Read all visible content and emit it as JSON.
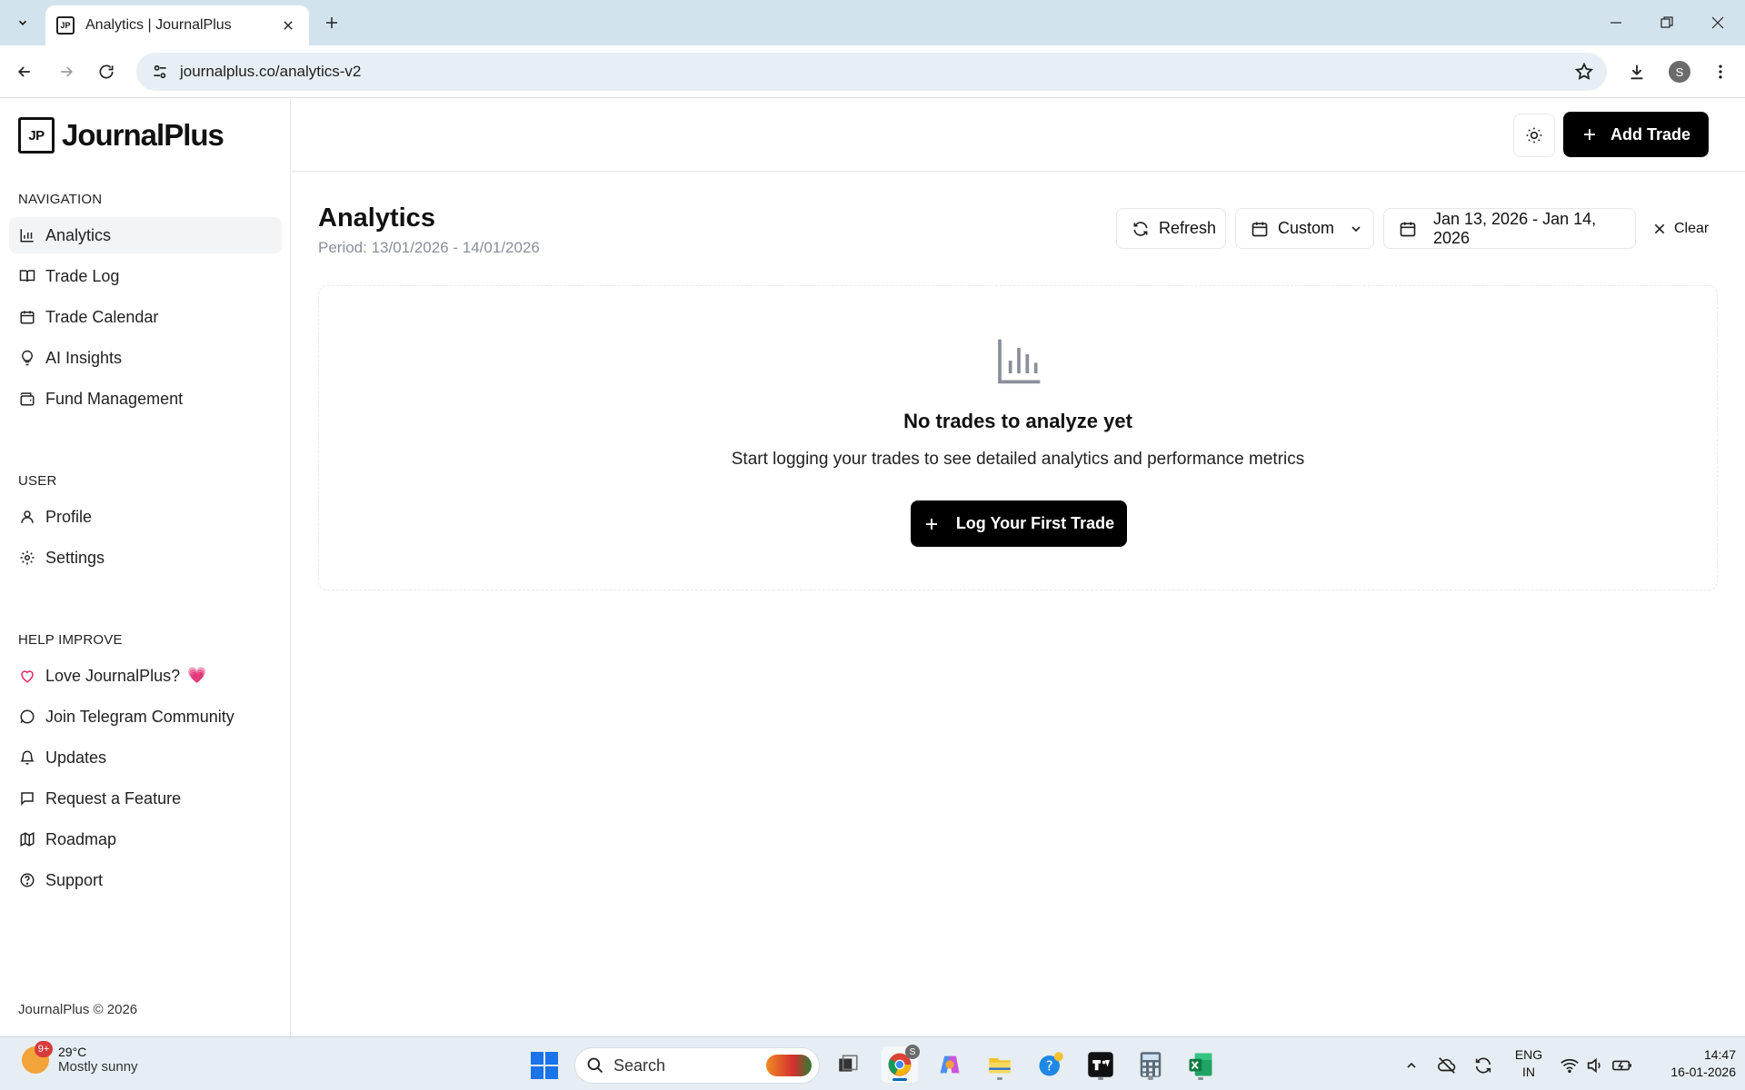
{
  "browser": {
    "tab_title": "Analytics | JournalPlus",
    "favicon_text": "JP",
    "url": "journalplus.co/analytics-v2",
    "profile_initial": "S"
  },
  "sidebar": {
    "logo_mark": "JP",
    "logo_text": "JournalPlus",
    "sections": {
      "navigation": "NAVIGATION",
      "user": "USER",
      "help": "HELP IMPROVE"
    },
    "nav_items": [
      {
        "label": "Analytics",
        "icon": "bar-chart-icon",
        "active": true
      },
      {
        "label": "Trade Log",
        "icon": "book-icon"
      },
      {
        "label": "Trade Calendar",
        "icon": "calendar-icon"
      },
      {
        "label": "AI Insights",
        "icon": "lightbulb-icon"
      },
      {
        "label": "Fund Management",
        "icon": "wallet-icon"
      }
    ],
    "user_items": [
      {
        "label": "Profile",
        "icon": "user-icon"
      },
      {
        "label": "Settings",
        "icon": "gear-icon"
      }
    ],
    "help_items": [
      {
        "label": "Love JournalPlus?",
        "icon": "heart-icon",
        "emoji": "💗"
      },
      {
        "label": "Join Telegram Community",
        "icon": "message-circle-icon"
      },
      {
        "label": "Updates",
        "icon": "bell-icon"
      },
      {
        "label": "Request a Feature",
        "icon": "message-square-icon"
      },
      {
        "label": "Roadmap",
        "icon": "map-icon"
      },
      {
        "label": "Support",
        "icon": "help-circle-icon"
      }
    ],
    "footer": "JournalPlus © 2026"
  },
  "topbar": {
    "add_trade_label": "Add Trade"
  },
  "page": {
    "title": "Analytics",
    "period": "Period: 13/01/2026 - 14/01/2026",
    "refresh_label": "Refresh",
    "range_preset": "Custom",
    "date_range": "Jan 13, 2026 - Jan 14, 2026",
    "clear_label": "Clear"
  },
  "empty_state": {
    "title": "No trades to analyze yet",
    "subtitle": "Start logging your trades to see detailed analytics and performance metrics",
    "cta_label": "Log Your First Trade"
  },
  "taskbar": {
    "weather_badge": "9+",
    "temperature": "29°C",
    "weather_desc": "Mostly sunny",
    "search_label": "Search",
    "lang_line1": "ENG",
    "lang_line2": "IN",
    "time": "14:47",
    "date": "16-01-2026",
    "chrome_badge": "S"
  },
  "colors": {
    "accent": "#000000",
    "heart": "#e0245e",
    "chrome_tabbar": "#d3e3ee",
    "taskbar": "#e6eef3"
  }
}
